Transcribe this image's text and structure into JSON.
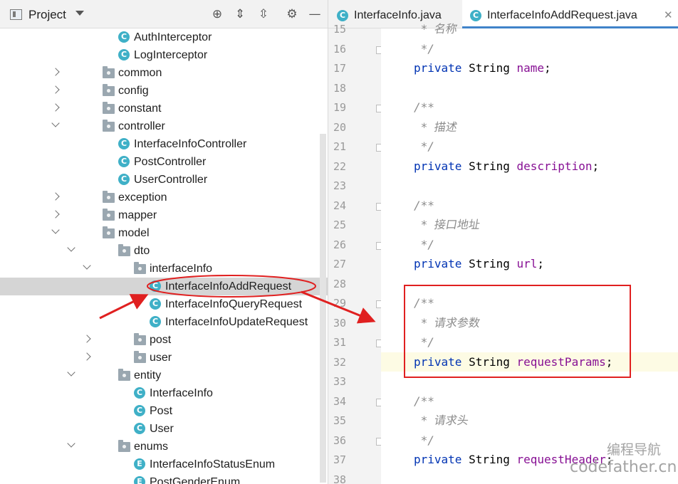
{
  "project_panel": {
    "title": "Project",
    "tree": [
      {
        "label": "AuthInterceptor",
        "kind": "class",
        "depth": 3,
        "arrow": "none"
      },
      {
        "label": "LogInterceptor",
        "kind": "class",
        "depth": 3,
        "arrow": "none"
      },
      {
        "label": "common",
        "kind": "folder",
        "depth": 2,
        "arrow": "closed"
      },
      {
        "label": "config",
        "kind": "folder",
        "depth": 2,
        "arrow": "closed"
      },
      {
        "label": "constant",
        "kind": "folder",
        "depth": 2,
        "arrow": "closed"
      },
      {
        "label": "controller",
        "kind": "folder",
        "depth": 2,
        "arrow": "open"
      },
      {
        "label": "InterfaceInfoController",
        "kind": "class",
        "depth": 3,
        "arrow": "none"
      },
      {
        "label": "PostController",
        "kind": "class",
        "depth": 3,
        "arrow": "none"
      },
      {
        "label": "UserController",
        "kind": "class",
        "depth": 3,
        "arrow": "none"
      },
      {
        "label": "exception",
        "kind": "folder",
        "depth": 2,
        "arrow": "closed"
      },
      {
        "label": "mapper",
        "kind": "folder",
        "depth": 2,
        "arrow": "closed"
      },
      {
        "label": "model",
        "kind": "folder",
        "depth": 2,
        "arrow": "open"
      },
      {
        "label": "dto",
        "kind": "folder",
        "depth": 3,
        "arrow": "open"
      },
      {
        "label": "interfaceInfo",
        "kind": "folder",
        "depth": 4,
        "arrow": "open"
      },
      {
        "label": "InterfaceInfoAddRequest",
        "kind": "class",
        "depth": 5,
        "arrow": "none",
        "selected": true
      },
      {
        "label": "InterfaceInfoQueryRequest",
        "kind": "class",
        "depth": 5,
        "arrow": "none"
      },
      {
        "label": "InterfaceInfoUpdateRequest",
        "kind": "class",
        "depth": 5,
        "arrow": "none"
      },
      {
        "label": "post",
        "kind": "folder",
        "depth": 4,
        "arrow": "closed"
      },
      {
        "label": "user",
        "kind": "folder",
        "depth": 4,
        "arrow": "closed"
      },
      {
        "label": "entity",
        "kind": "folder",
        "depth": 3,
        "arrow": "open"
      },
      {
        "label": "InterfaceInfo",
        "kind": "class",
        "depth": 4,
        "arrow": "none"
      },
      {
        "label": "Post",
        "kind": "class",
        "depth": 4,
        "arrow": "none"
      },
      {
        "label": "User",
        "kind": "class",
        "depth": 4,
        "arrow": "none"
      },
      {
        "label": "enums",
        "kind": "folder",
        "depth": 3,
        "arrow": "open"
      },
      {
        "label": "InterfaceInfoStatusEnum",
        "kind": "enum",
        "depth": 4,
        "arrow": "none"
      },
      {
        "label": "PostGenderEnum",
        "kind": "enum",
        "depth": 4,
        "arrow": "none"
      }
    ]
  },
  "editor": {
    "tabs": [
      {
        "label": "InterfaceInfo.java",
        "active": false
      },
      {
        "label": "InterfaceInfoAddRequest.java",
        "active": true
      }
    ],
    "highlighted_line": 32,
    "lines": [
      {
        "n": "15",
        "tokens": [
          {
            "t": " * 名称",
            "c": "cm"
          }
        ]
      },
      {
        "n": "16",
        "tokens": [
          {
            "t": " */",
            "c": "cm"
          }
        ]
      },
      {
        "n": "17",
        "tokens": [
          {
            "t": "private ",
            "c": "kw"
          },
          {
            "t": "String ",
            "c": "ty"
          },
          {
            "t": "name",
            "c": "fld"
          },
          {
            "t": ";",
            "c": "pun"
          }
        ]
      },
      {
        "n": "18",
        "tokens": []
      },
      {
        "n": "19",
        "tokens": [
          {
            "t": "/**",
            "c": "cm"
          }
        ]
      },
      {
        "n": "20",
        "tokens": [
          {
            "t": " * 描述",
            "c": "cm"
          }
        ]
      },
      {
        "n": "21",
        "tokens": [
          {
            "t": " */",
            "c": "cm"
          }
        ]
      },
      {
        "n": "22",
        "tokens": [
          {
            "t": "private ",
            "c": "kw"
          },
          {
            "t": "String ",
            "c": "ty"
          },
          {
            "t": "description",
            "c": "fld"
          },
          {
            "t": ";",
            "c": "pun"
          }
        ]
      },
      {
        "n": "23",
        "tokens": []
      },
      {
        "n": "24",
        "tokens": [
          {
            "t": "/**",
            "c": "cm"
          }
        ]
      },
      {
        "n": "25",
        "tokens": [
          {
            "t": " * 接口地址",
            "c": "cm"
          }
        ]
      },
      {
        "n": "26",
        "tokens": [
          {
            "t": " */",
            "c": "cm"
          }
        ]
      },
      {
        "n": "27",
        "tokens": [
          {
            "t": "private ",
            "c": "kw"
          },
          {
            "t": "String ",
            "c": "ty"
          },
          {
            "t": "url",
            "c": "fld"
          },
          {
            "t": ";",
            "c": "pun"
          }
        ]
      },
      {
        "n": "28",
        "tokens": []
      },
      {
        "n": "29",
        "tokens": [
          {
            "t": "/**",
            "c": "cm"
          }
        ]
      },
      {
        "n": "30",
        "tokens": [
          {
            "t": " * 请求参数",
            "c": "cm"
          }
        ]
      },
      {
        "n": "31",
        "tokens": [
          {
            "t": " */",
            "c": "cm"
          }
        ]
      },
      {
        "n": "32",
        "tokens": [
          {
            "t": "private ",
            "c": "kw"
          },
          {
            "t": "String ",
            "c": "ty"
          },
          {
            "t": "requestParams",
            "c": "fld"
          },
          {
            "t": ";",
            "c": "pun"
          }
        ]
      },
      {
        "n": "33",
        "tokens": []
      },
      {
        "n": "34",
        "tokens": [
          {
            "t": "/**",
            "c": "cm"
          }
        ]
      },
      {
        "n": "35",
        "tokens": [
          {
            "t": " * 请求头",
            "c": "cm"
          }
        ]
      },
      {
        "n": "36",
        "tokens": [
          {
            "t": " */",
            "c": "cm"
          }
        ]
      },
      {
        "n": "37",
        "tokens": [
          {
            "t": "private ",
            "c": "kw"
          },
          {
            "t": "String ",
            "c": "ty"
          },
          {
            "t": "requestHeader",
            "c": "fld"
          },
          {
            "t": ";",
            "c": "pun"
          }
        ]
      },
      {
        "n": "38",
        "tokens": []
      }
    ]
  },
  "watermark": {
    "line1": "编程导航",
    "line2": "codefather.cn"
  },
  "colors": {
    "annotation_red": "#e02020",
    "keyword": "#0033b3",
    "field": "#871094",
    "comment": "#8c8c8c",
    "class_icon": "#3fb0c7",
    "tab_underline": "#4083c9"
  }
}
